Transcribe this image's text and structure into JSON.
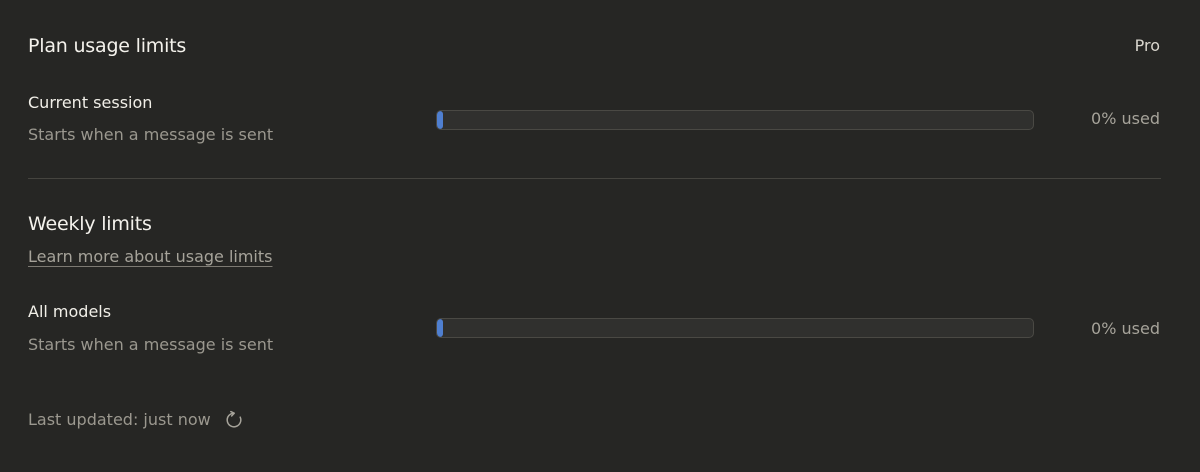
{
  "plan": {
    "title": "Plan usage limits",
    "badge": "Pro"
  },
  "current_session": {
    "label": "Current session",
    "subtitle": "Starts when a message is sent",
    "usage_percent": 0,
    "usage_text": "0% used"
  },
  "weekly": {
    "title": "Weekly limits",
    "learn_more": "Learn more about usage limits",
    "all_models": {
      "label": "All models",
      "subtitle": "Starts when a message is sent",
      "usage_percent": 0,
      "usage_text": "0% used"
    }
  },
  "footer": {
    "last_updated": "Last updated: just now",
    "refresh_icon": "refresh-icon"
  },
  "colors": {
    "background": "#262624",
    "bar_fill": "#4f7fd0",
    "bar_track": "#30302e"
  }
}
